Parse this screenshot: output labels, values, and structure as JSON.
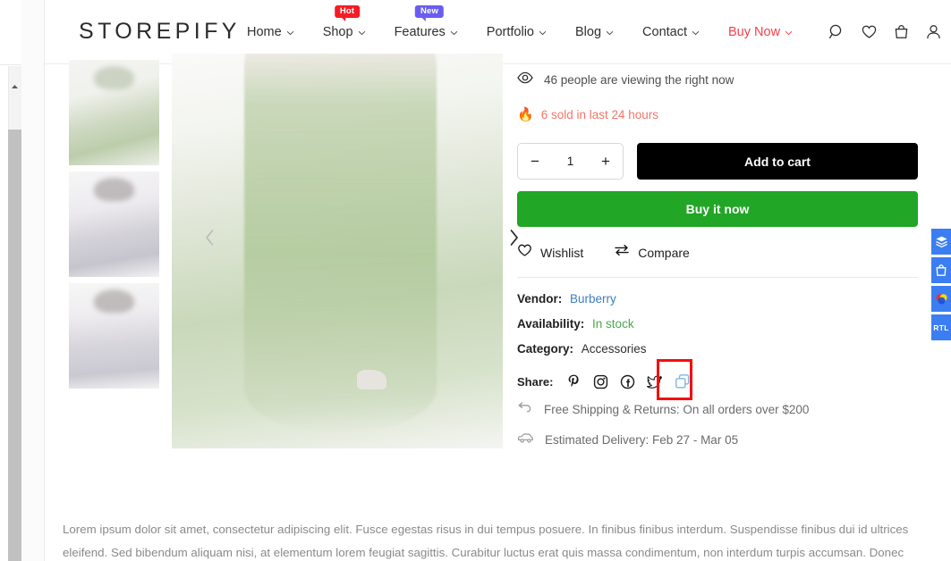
{
  "header": {
    "logo": "STOREPIFY",
    "nav": [
      {
        "label": "Home",
        "caret": "∨",
        "badge": null,
        "accent": false
      },
      {
        "label": "Shop",
        "caret": "∨",
        "badge": "Hot",
        "badge_color": "#f51c25",
        "accent": false
      },
      {
        "label": "Features",
        "caret": "∨",
        "badge": "New",
        "badge_color": "#6a5cf0",
        "accent": false
      },
      {
        "label": "Portfolio",
        "caret": "∨",
        "badge": null,
        "accent": false
      },
      {
        "label": "Blog",
        "caret": "∨",
        "badge": null,
        "accent": false
      },
      {
        "label": "Contact",
        "caret": "∨",
        "badge": null,
        "accent": false
      },
      {
        "label": "Buy Now",
        "caret": "∨",
        "badge": null,
        "accent": true
      }
    ],
    "icons": [
      "search-icon",
      "wishlist-heart-icon",
      "shopping-bag-icon",
      "account-user-icon"
    ]
  },
  "gallery": {
    "thumbnails": [
      {
        "alt": "green tulle maxi dress back view"
      },
      {
        "alt": "grey embellished maxi dress front view"
      },
      {
        "alt": "grey embellished maxi dress pose"
      }
    ],
    "main_image_alt": "model wearing sage green tulle maxi dress",
    "prev_arrow": "‹",
    "next_arrow": "›"
  },
  "product": {
    "viewing_text": "46 people are viewing the right now",
    "sold_text": "6 sold in last 24 hours",
    "sold_color": "#f4756a",
    "quantity": {
      "minus": "−",
      "value": "1",
      "plus": "+"
    },
    "add_to_cart_label": "Add to cart",
    "buy_now_label": "Buy it now",
    "wishlist_label": "Wishlist",
    "compare_label": "Compare",
    "facts": [
      {
        "label": "Vendor:",
        "value": "Burberry",
        "value_style": "v-vendor"
      },
      {
        "label": "Availability:",
        "value": "In stock",
        "value_style": "v-stock"
      },
      {
        "label": "Category:",
        "value": "Accessories",
        "value_style": "v-plain"
      }
    ],
    "share_label": "Share:",
    "share_icons": [
      "pinterest-icon",
      "instagram-icon",
      "facebook-icon",
      "twitter-icon",
      "copy-link-icon"
    ],
    "shipping_text": "Free Shipping & Returns: On all orders over $200",
    "delivery_text": "Estimated Delivery: Feb 27 - Mar 05"
  },
  "side_tools": [
    {
      "name": "layers-icon",
      "label": ""
    },
    {
      "name": "bag-icon",
      "label": ""
    },
    {
      "name": "color-wheel-icon",
      "label": ""
    },
    {
      "name": "rtl-toggle",
      "label": "RTL"
    }
  ],
  "description": "Lorem ipsum dolor sit amet, consectetur adipiscing elit. Fusce egestas risus in dui tempus posuere. In finibus finibus interdum. Suspendisse finibus dui id ultrices eleifend. Sed bibendum aliquam nisi, at elementum lorem feugiat sagittis. Curabitur luctus erat quis massa condimentum, non interdum turpis accumsan. Donec",
  "colors": {
    "accent_red": "#f5404a",
    "buy_green": "#21a625",
    "cart_black": "#000000",
    "link_blue": "#3a7fc4",
    "stock_green": "#4aa94e",
    "highlight_box": "#f50e0e",
    "side_tool_blue": "#3b7ef2"
  }
}
